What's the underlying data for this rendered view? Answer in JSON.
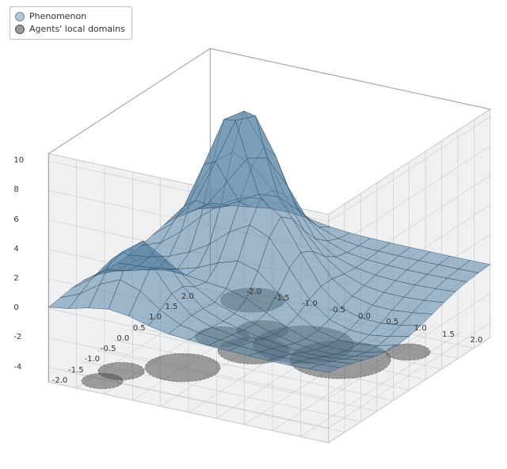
{
  "chart_data": {
    "type": "surface-3d",
    "title": "",
    "legend": [
      {
        "label": "Phenomenon",
        "series": "surface"
      },
      {
        "label": "Agents' local domains",
        "series": "disks"
      }
    ],
    "axes": {
      "x": {
        "label": "",
        "range": [
          -2.5,
          2.5
        ],
        "ticks": [
          -2.0,
          -1.5,
          -1.0,
          -0.5,
          0.0,
          0.5,
          1.0,
          1.5,
          2.0
        ]
      },
      "y": {
        "label": "",
        "range": [
          -2.5,
          2.5
        ],
        "ticks": [
          -2.0,
          -1.5,
          -1.0,
          -0.5,
          0.0,
          0.5,
          1.0,
          1.5,
          2.0
        ]
      },
      "z": {
        "label": "",
        "range": [
          -5,
          10.5
        ],
        "ticks": [
          -4,
          -2,
          0,
          2,
          4,
          6,
          8,
          10
        ]
      }
    },
    "surface": {
      "description": "Smooth multi-peak scalar field over [-2.5,2.5]^2 (sum of three Gaussian bumps minus one Gaussian dip)",
      "grid_size": 15,
      "color": "#5b87a8",
      "alpha": 0.55,
      "components": [
        {
          "type": "gaussian",
          "amp": 9.5,
          "cx": 1.2,
          "cy": -1.2,
          "sigma": 0.55
        },
        {
          "type": "gaussian",
          "amp": 4.8,
          "cx": 0.3,
          "cy": -0.2,
          "sigma": 0.55
        },
        {
          "type": "gaussian",
          "amp": 4.2,
          "cx": -1.6,
          "cy": -1.4,
          "sigma": 0.5
        },
        {
          "type": "gaussian",
          "amp": -2.0,
          "cx": -0.4,
          "cy": 1.6,
          "sigma": 1.1
        }
      ]
    },
    "disks": {
      "z_plane": -5,
      "color": "#555555",
      "alpha": 0.5,
      "items": [
        {
          "cx": -2.05,
          "cy": -1.8,
          "r": 0.32
        },
        {
          "cx": -1.55,
          "cy": -1.75,
          "r": 0.36
        },
        {
          "cx": -0.95,
          "cy": -1.0,
          "r": 0.58
        },
        {
          "cx": 0.2,
          "cy": -0.4,
          "r": 0.55
        },
        {
          "cx": 0.45,
          "cy": -1.1,
          "r": 0.42
        },
        {
          "cx": 0.8,
          "cy": 0.15,
          "r": 0.78
        },
        {
          "cx": 0.55,
          "cy": 0.95,
          "r": 0.78
        },
        {
          "cx": 1.0,
          "cy": -0.7,
          "r": 0.4
        },
        {
          "cx": 1.35,
          "cy": 1.7,
          "r": 0.34
        },
        {
          "cx": 2.0,
          "cy": -1.45,
          "r": 0.5
        }
      ]
    },
    "view": {
      "azimuth_deg": -60,
      "elevation_deg": 28
    },
    "colors": {
      "surface": "#5b87a8",
      "wire": "#2f4c60",
      "disk": "#555555",
      "pane": "#eef0f2",
      "grid": "#c8c8c8"
    }
  }
}
